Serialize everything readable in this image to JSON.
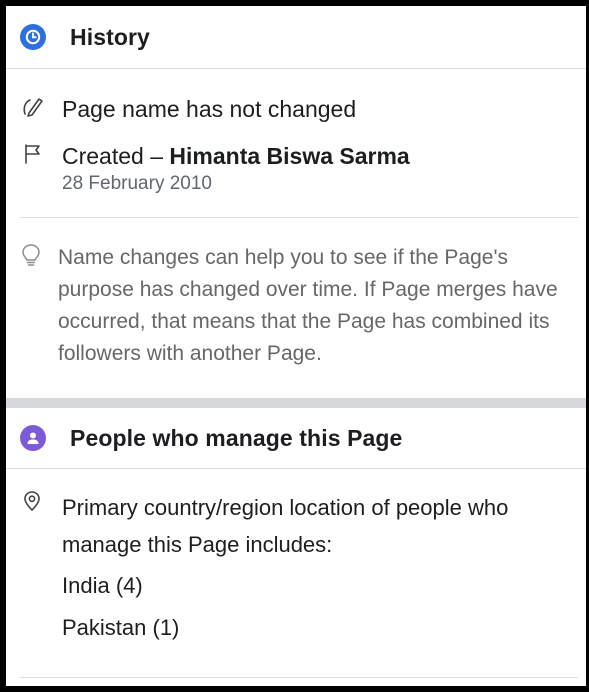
{
  "history": {
    "title": "History",
    "icon": "clock-icon",
    "accent": "#2d6fe0",
    "name_status": "Page name has not changed",
    "created_prefix": "Created – ",
    "created_by": "Himanta Biswa Sarma",
    "created_date": "28 February 2010",
    "info": "Name changes can help you to see if the Page's purpose has changed over time. If Page merges have occurred, that means that the Page has combined its followers with another Page."
  },
  "managers": {
    "title": "People who manage this Page",
    "icon": "person-icon",
    "accent": "#7c5cd6",
    "location_text": "Primary country/region location of people who manage this Page includes:",
    "countries": [
      "India (4)",
      "Pakistan (1)"
    ]
  }
}
